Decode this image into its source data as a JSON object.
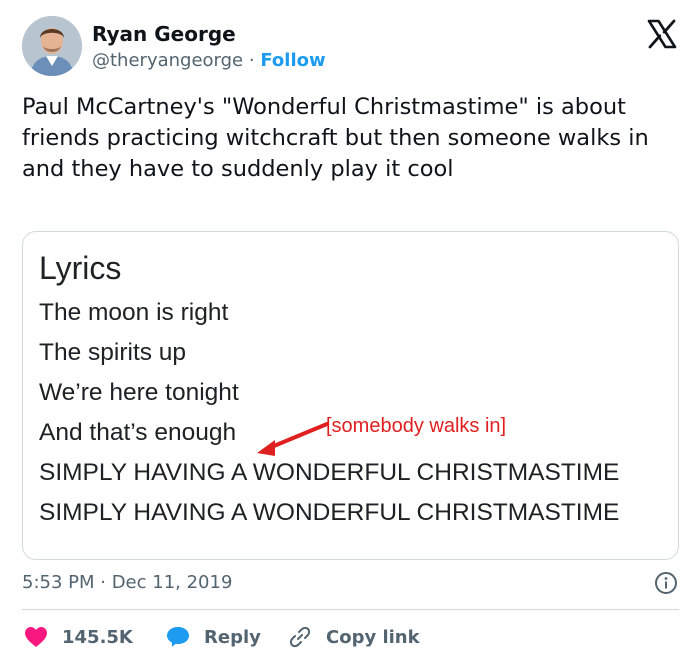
{
  "author": {
    "name": "Ryan George",
    "handle": "@theryangeorge",
    "separator": "·",
    "follow_label": "Follow"
  },
  "logo_icon": "x-logo",
  "tweet_text": "Paul McCartney's \"Wonderful Christmastime\" is about friends practicing witchcraft but then someone walks in and they have to suddenly play it cool",
  "card": {
    "title": "Lyrics",
    "lines": [
      "The moon is right",
      "The spirits up",
      "We’re here tonight",
      "And that’s enough",
      "SIMPLY HAVING A WONDERFUL CHRISTMASTIME",
      "SIMPLY HAVING A WONDERFUL CHRISTMASTIME"
    ],
    "annotation": "[somebody walks in]",
    "annotation_color": "#e02020"
  },
  "timestamp": "5:53 PM · Dec 11, 2019",
  "actions": {
    "like_count": "145.5K",
    "reply_label": "Reply",
    "copy_label": "Copy link"
  },
  "colors": {
    "accent": "#1d9bf0",
    "like": "#f91880",
    "muted": "#536471",
    "text": "#0f1419"
  }
}
